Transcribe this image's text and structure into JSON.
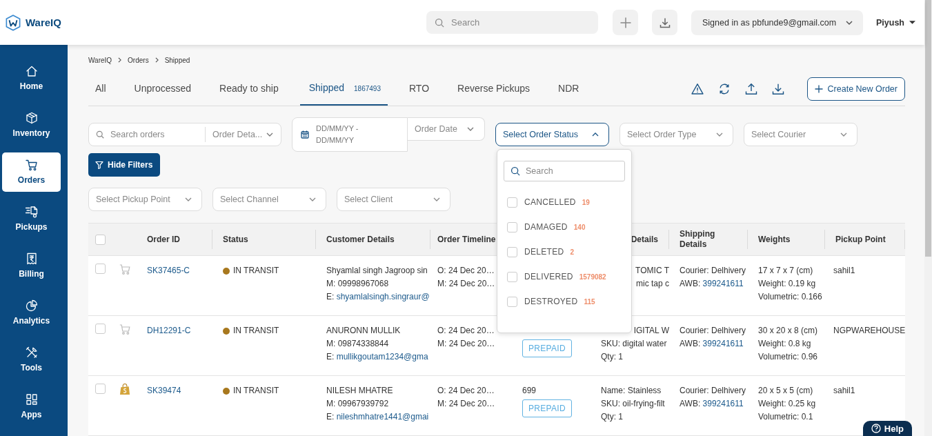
{
  "header": {
    "logo_text": "WareIQ",
    "search_placeholder": "Search",
    "account": "Signed in as pbfunde9@gmail.com",
    "user": "Piyush"
  },
  "sidebar": {
    "items": [
      {
        "label": "Home",
        "selected": false
      },
      {
        "label": "Inventory",
        "selected": false
      },
      {
        "label": "Orders",
        "selected": true
      },
      {
        "label": "Pickups",
        "selected": false
      },
      {
        "label": "Billing",
        "selected": false
      },
      {
        "label": "Analytics",
        "selected": false
      },
      {
        "label": "Tools",
        "selected": false
      },
      {
        "label": "Apps",
        "selected": false
      }
    ]
  },
  "breadcrumbs": [
    "WareIQ",
    "Orders",
    "Shipped"
  ],
  "tabs": [
    {
      "label": "All",
      "selected": false
    },
    {
      "label": "Unprocessed",
      "selected": false
    },
    {
      "label": "Ready to ship",
      "selected": false
    },
    {
      "label": "Shipped",
      "count": "1867493",
      "selected": true
    },
    {
      "label": "RTO",
      "selected": false
    },
    {
      "label": "Reverse Pickups",
      "selected": false
    },
    {
      "label": "NDR",
      "selected": false
    }
  ],
  "create_button": "Create New Order",
  "filters": {
    "order_search": {
      "placeholder": "Search orders",
      "field": "Order Deta..."
    },
    "date_range": {
      "placeholder": "DD/MM/YY - DD/MM/YY",
      "field": "Order Date"
    },
    "selects": [
      {
        "placeholder": "Select Order Status",
        "open": true
      },
      {
        "placeholder": "Select Order Type",
        "open": false
      },
      {
        "placeholder": "Select Courier",
        "open": false
      }
    ],
    "hide_button": "Hide Filters",
    "more_selects": [
      {
        "placeholder": "Select Pickup Point",
        "open": false
      },
      {
        "placeholder": "Select Channel",
        "open": false
      },
      {
        "placeholder": "Select Client",
        "open": false
      }
    ]
  },
  "status_menu": {
    "search_placeholder": "Search",
    "options": [
      {
        "label": "CANCELLED",
        "count": "19",
        "checked": false
      },
      {
        "label": "DAMAGED",
        "count": "140",
        "checked": false
      },
      {
        "label": "DELETED",
        "count": "2",
        "checked": false
      },
      {
        "label": "DELIVERED",
        "count": "1579082",
        "checked": false
      },
      {
        "label": "DESTROYED",
        "count": "115",
        "checked": false
      }
    ]
  },
  "table": {
    "all_checked": false,
    "columns": [
      {
        "label": "Order ID"
      },
      {
        "label": "Status"
      },
      {
        "label": "Customer Details"
      },
      {
        "label": "Order Timeline"
      },
      {},
      {
        "label": "Details"
      },
      {
        "label": "Shipping\nDetails"
      },
      {
        "label": "Weights"
      },
      {
        "label": "Pickup Point"
      }
    ],
    "rows": [
      {
        "checked": false,
        "kind": "cart",
        "order_id": "SK37465-C",
        "status": {
          "label": "IN TRANSIT",
          "color": "#a8781e"
        },
        "customer": {
          "name": "Shyamlal singh Jagroop sin",
          "mobile": "M: 09998967068",
          "email_label": "E:",
          "email": "shyamlalsingh.singraur@"
        },
        "timeline": [
          "O: 24 Dec 20…",
          "M: 24 Dec 20…"
        ],
        "product": [
          "TOMIC T",
          "mic tap c"
        ],
        "shipping": {
          "courier": "Courier: Delhivery",
          "awb_label": "AWB:",
          "awb": "399241611"
        },
        "weights": [
          "17 x 7 x 7 (cm)",
          "Weight: 0.19 kg",
          "Volumetric: 0.166"
        ],
        "pickup": "sahil1"
      },
      {
        "checked": false,
        "kind": "cart",
        "order_id": "DH12291-C",
        "status": {
          "label": "IN TRANSIT",
          "color": "#a8781e"
        },
        "customer": {
          "name": "ANURONN MULLIK",
          "mobile": "M: 09874338844",
          "email_label": "E:",
          "email": "mullikgoutam1234@gma"
        },
        "timeline": [
          "O: 24 Dec 20…",
          "M: 24 Dec 20…"
        ],
        "payment": {
          "mode": "PREPAID"
        },
        "product": [
          "IGITAL W",
          "SKU: digital water",
          "Qty: 1"
        ],
        "shipping": {
          "courier": "Courier: Delhivery",
          "awb_label": "AWB:",
          "awb": "399241611"
        },
        "weights": [
          "30 x 20 x 8 (cm)",
          "Weight: 0.8 kg",
          "Volumetric: 0.96"
        ],
        "pickup": "NGPWAREHOUSE"
      },
      {
        "checked": false,
        "kind": "shop",
        "order_id": "SK39474",
        "status": {
          "label": "IN TRANSIT",
          "color": "#a8781e"
        },
        "customer": {
          "name": "NILESH MHATRE",
          "mobile": "M: 09967939792",
          "email_label": "E:",
          "email": "nileshmhatre1441@gmai"
        },
        "timeline": [
          "O: 24 Dec 20…",
          "M: 24 Dec 20…"
        ],
        "payment": {
          "amount": "699",
          "mode": "PREPAID"
        },
        "product": [
          "Name: Stainless",
          "SKU: oil-frying-filt",
          "Qty: 1"
        ],
        "shipping": {
          "courier": "Courier: Delhivery",
          "awb_label": "AWB:",
          "awb": "399241611"
        },
        "weights": [
          "20 x 5 x 5 (cm)",
          "Weight: 0.25 kg",
          "Volumetric: 0.1"
        ],
        "pickup": "sahil1"
      }
    ]
  },
  "help_button": "Help"
}
